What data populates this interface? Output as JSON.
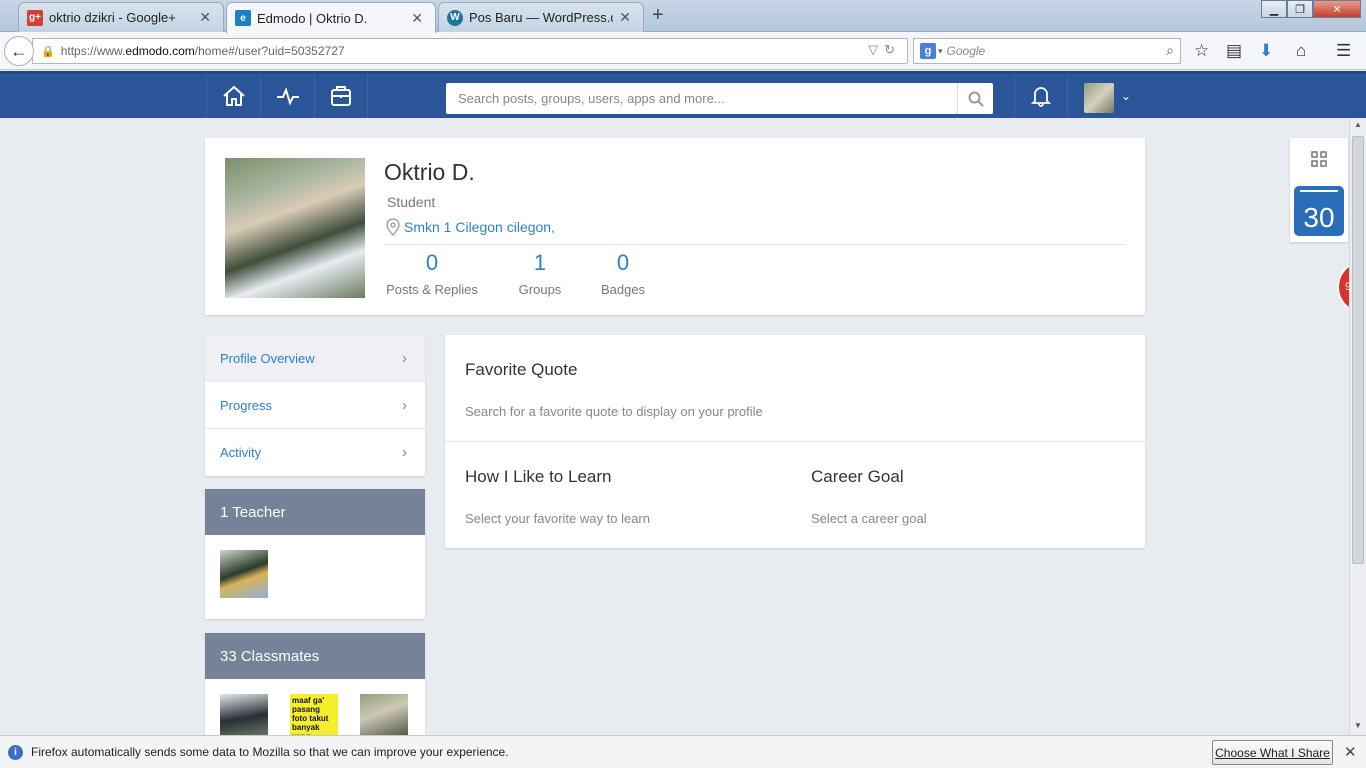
{
  "browser": {
    "tabs": [
      {
        "title": "oktrio dzikri - Google+",
        "icon": "gplus-icon",
        "color": "#d73d32"
      },
      {
        "title": "Edmodo | Oktrio D.",
        "icon": "edmodo-icon",
        "color": "#1a7fc4"
      },
      {
        "title": "Pos Baru — WordPress.com",
        "icon": "wordpress-icon",
        "color": "#21759b"
      }
    ],
    "url_prefix": "https://www.",
    "url_domain": "edmodo.com",
    "url_suffix": "/home#/user?uid=50352727",
    "search_placeholder": "Google"
  },
  "header": {
    "search_placeholder": "Search posts, groups, users, apps and more...",
    "color": "#2a5699"
  },
  "profile": {
    "name": "Oktrio D.",
    "role": "Student",
    "school": "Smkn 1 Cilegon cilegon,",
    "stats": [
      {
        "value": "0",
        "label": "Posts & Replies"
      },
      {
        "value": "1",
        "label": "Groups"
      },
      {
        "value": "0",
        "label": "Badges"
      }
    ]
  },
  "sidenav": {
    "items": [
      "Profile Overview",
      "Progress",
      "Activity"
    ]
  },
  "teachers": {
    "heading": "1 Teacher"
  },
  "classmates": {
    "heading": "33 Classmates",
    "thumb_text": "maaf ga' pasang foto takut banyak yang naksir"
  },
  "main": {
    "quote_title": "Favorite Quote",
    "quote_sub": "Search for a favorite quote to display on your profile",
    "learn_title": "How I Like to Learn",
    "learn_sub": "Select your favorite way to learn",
    "career_title": "Career Goal",
    "career_sub": "Select a career goal"
  },
  "right_panel": {
    "calendar_day": "30",
    "badge_count": "96"
  },
  "notification": {
    "text": "Firefox automatically sends some data to Mozilla so that we can improve your experience.",
    "button": "Choose What I Share"
  }
}
